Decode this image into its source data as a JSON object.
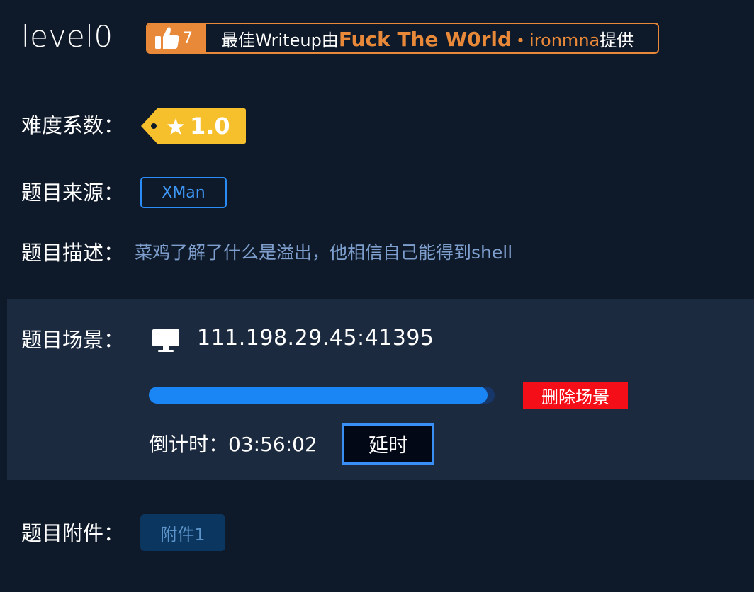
{
  "challenge": {
    "title": "level0"
  },
  "writeup": {
    "likes": "7",
    "prefix": "最佳Writeup由",
    "team": "Fuck The W0rld",
    "separator": "•",
    "user": "ironmna",
    "suffix": "提供",
    "icon": "thumbs-up-icon",
    "accent_color": "#e8893a"
  },
  "difficulty": {
    "label": "难度系数：",
    "value": "1.0",
    "icon": "star-icon",
    "color": "#f6c02c"
  },
  "source": {
    "label": "题目来源：",
    "value": "XMan",
    "color": "#2a8df7"
  },
  "description": {
    "label": "题目描述：",
    "text": "菜鸡了解了什么是溢出，他相信自己能得到shell"
  },
  "scene": {
    "label": "题目场景：",
    "icon": "monitor-icon",
    "address": "111.198.29.45:41395",
    "progress": 0.98,
    "delete_label": "删除场景",
    "countdown_label": "倒计时：",
    "countdown_value": "03:56:02",
    "extend_label": "延时"
  },
  "attachment": {
    "label": "题目附件：",
    "button_label": "附件1"
  }
}
